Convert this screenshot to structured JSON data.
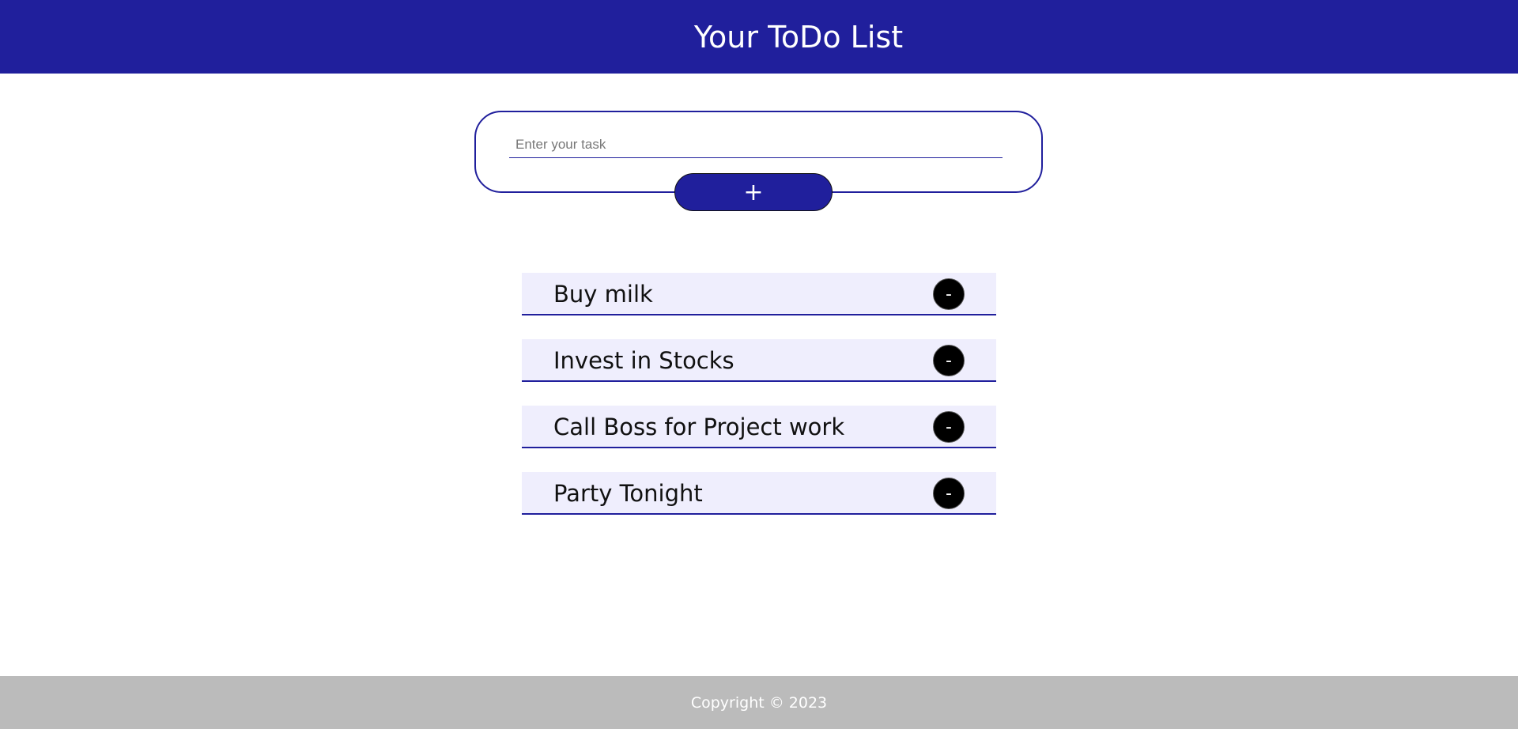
{
  "header": {
    "title": "Your ToDo List"
  },
  "input_card": {
    "placeholder": "Enter your task",
    "value": "",
    "add_label": "+"
  },
  "tasks": [
    {
      "label": "Buy milk",
      "remove_label": "-"
    },
    {
      "label": "Invest in Stocks",
      "remove_label": "-"
    },
    {
      "label": "Call Boss for Project work",
      "remove_label": "-"
    },
    {
      "label": "Party Tonight",
      "remove_label": "-"
    }
  ],
  "footer": {
    "text": "Copyright © 2023"
  },
  "colors": {
    "primary": "#201f9c",
    "task_bg": "#efeefd",
    "footer_bg": "#bbbbbb",
    "remove_bg": "#000000"
  }
}
